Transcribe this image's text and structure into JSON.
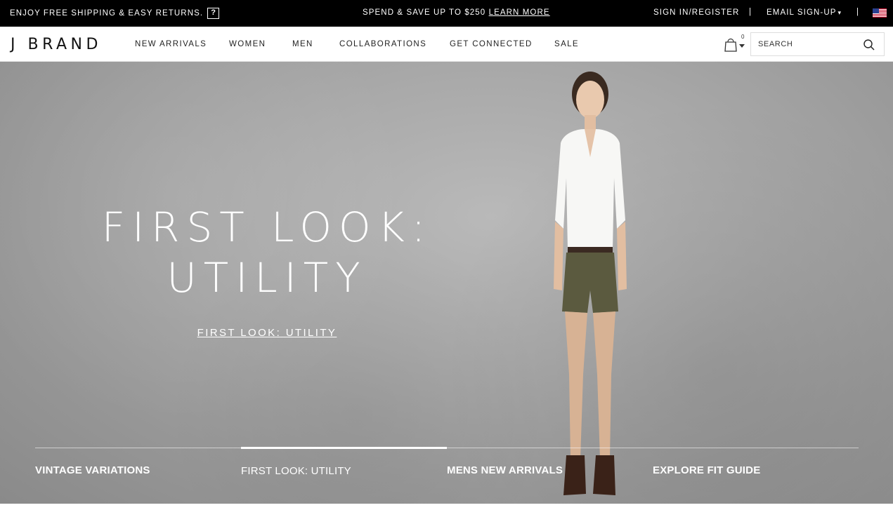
{
  "topbar": {
    "free_shipping": "ENJOY FREE SHIPPING & EASY RETURNS.",
    "help_icon": "?",
    "promo_text": "SPEND & SAVE UP TO $250",
    "promo_link": "LEARN MORE",
    "sign_in": "SIGN IN/REGISTER",
    "separator": "|",
    "email_signup": "EMAIL SIGN-UP",
    "caret": "▾",
    "flag_icon": "us-flag-icon"
  },
  "nav": {
    "logo": "J BRAND",
    "items": [
      "NEW ARRIVALS",
      "WOMEN",
      "MEN",
      "COLLABORATIONS",
      "GET CONNECTED",
      "SALE"
    ],
    "cart_count": "0",
    "search_placeholder": "SEARCH"
  },
  "hero": {
    "title_line1": "FIRST LOOK:",
    "title_line2": "UTILITY",
    "cta_link": "FIRST LOOK: UTILITY",
    "tabs": [
      {
        "label": "VINTAGE VARIATIONS",
        "active": false
      },
      {
        "label": "FIRST LOOK: UTILITY",
        "active": true
      },
      {
        "label": "MENS NEW ARRIVALS",
        "active": false
      },
      {
        "label": "EXPLORE FIT GUIDE",
        "active": false
      }
    ]
  },
  "colors": {
    "topbar_bg": "#000000",
    "hero_bg": "#a5a5a5",
    "text_on_hero": "#ffffff"
  }
}
